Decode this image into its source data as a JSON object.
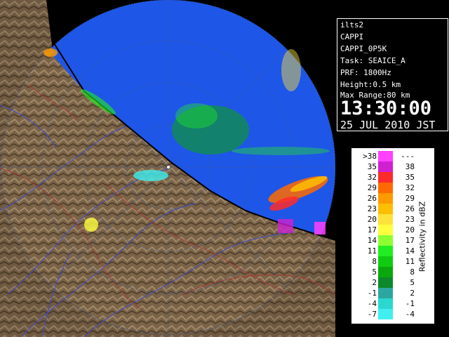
{
  "info": {
    "radar_name": "ilts2",
    "product": "CAPPI",
    "product_id": "CAPPI_0P5K",
    "task": "Task: SEAICE_A",
    "prf": "PRF: 1800Hz",
    "height": "Height:0.5 km",
    "max_range": "Max Range:80 km",
    "time": "13:30:00",
    "date": "25 JUL 2010 JST"
  },
  "legend": {
    "title": "Reflectivity in dBZ",
    "rows": [
      {
        "left": ">38",
        "right": "---",
        "color": "#ff40ff"
      },
      {
        "left": "35",
        "right": "38",
        "color": "#d020d0"
      },
      {
        "left": "32",
        "right": "35",
        "color": "#ff2a2a"
      },
      {
        "left": "29",
        "right": "32",
        "color": "#ff6a00"
      },
      {
        "left": "26",
        "right": "29",
        "color": "#ff9a00"
      },
      {
        "left": "23",
        "right": "26",
        "color": "#ffbe00"
      },
      {
        "left": "20",
        "right": "23",
        "color": "#ffe23a"
      },
      {
        "left": "17",
        "right": "20",
        "color": "#ffff40"
      },
      {
        "left": "14",
        "right": "17",
        "color": "#8cff30"
      },
      {
        "left": "11",
        "right": "14",
        "color": "#20ee20"
      },
      {
        "left": "8",
        "right": "11",
        "color": "#10cc10"
      },
      {
        "left": "5",
        "right": "8",
        "color": "#0aa80a"
      },
      {
        "left": "2",
        "right": "5",
        "color": "#0c8a2a"
      },
      {
        "left": "-1",
        "right": "2",
        "color": "#2aa8a0"
      },
      {
        "left": "-4",
        "right": "-1",
        "color": "#2ad8d0"
      },
      {
        "left": "-7",
        "right": "-4",
        "color": "#40f0f0"
      }
    ]
  },
  "colors": {
    "sea": "#1e56e8",
    "land": "#7a6448",
    "background": "#000000"
  }
}
